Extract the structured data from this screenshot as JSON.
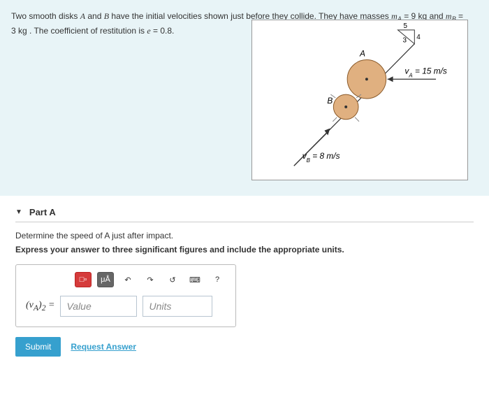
{
  "problem": {
    "text_html": "Two smooth disks <i>A</i> and <i>B</i> have the initial velocities shown just before they collide. They have masses <i>m<sub>A</sub></i> = 9&nbsp;kg and <i>m<sub>B</sub></i> = 3&nbsp;kg . The coefficient of restitution is <i>e</i> = 0.8.",
    "figure": {
      "disk_A_label": "A",
      "disk_B_label": "B",
      "vA_label": "v_A = 15 m/s",
      "vB_label": "v_B = 8 m/s",
      "triangle_top": "5",
      "triangle_right": "4",
      "triangle_hyp": "3"
    }
  },
  "part": {
    "label": "Part A",
    "question": "Determine the speed of A just after impact.",
    "instruction": "Express your answer to three significant figures and include the appropriate units.",
    "var_label_html": "(<i>v<sub>A</sub></i>)<sub>2</sub> =",
    "value_placeholder": "Value",
    "units_placeholder": "Units"
  },
  "toolbar": {
    "templates": "□▫",
    "greek": "μÅ",
    "undo": "↶",
    "redo": "↷",
    "reset": "↺",
    "keyboard": "⌨",
    "help": "?"
  },
  "actions": {
    "submit": "Submit",
    "request": "Request Answer"
  }
}
